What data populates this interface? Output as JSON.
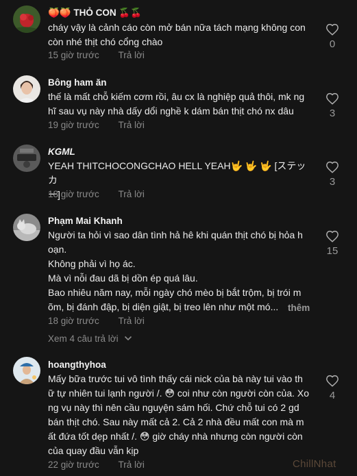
{
  "comments": [
    {
      "username": "🍑🍑 THỎ CON 🍒🍒",
      "lines": [
        "cháy vậy là cảnh cáo còn mở bán nữa tách mạng không con",
        "còn nhé thịt chó cổng chào"
      ],
      "time": "15 giờ trước",
      "reply": "Trả lời",
      "likes": "0",
      "avatar_icon": "avatar-red-flower-icon"
    },
    {
      "username": "Bông ham ăn",
      "lines": [
        "thế là mất chỗ kiếm cơm rồi, âu cx là nghiệp quả thôi, mk ng",
        "hĩ sau vụ này nhà dấy dổi nghề k dám bán thịt chó nx dâu"
      ],
      "time": "19 giờ trước",
      "reply": "Trả lời",
      "likes": "3",
      "avatar_icon": "avatar-woman-portrait-icon"
    },
    {
      "username": "KGML",
      "lines": [
        "YEAH THITCHOCONGCHAO HELL YEAH🤟 🤟 🤟 [ステッカ",
        "ー]"
      ],
      "time": "18 giờ trước",
      "reply": "Trả lời",
      "likes": "3",
      "avatar_icon": "avatar-gray-logo-icon"
    },
    {
      "username": "Phạm Mai Khanh",
      "lines": [
        "Người ta hỏi vì sao dân tình hả hê khi quán thịt chó bị hỏa h",
        "oạn.",
        "Không phải vì họ ác.",
        "Mà vì nỗi đau dã bị dồn ép quá lâu.",
        "Bao nhiêu năm nay, mỗi ngày chó mèo bị bắt trộm, bị trói m",
        "õm, bị đánh đập, bị diện giật, bị treo lên như một mó..."
      ],
      "more": "thêm",
      "time": "18 giờ trước",
      "reply": "Trả lời",
      "likes": "15",
      "view_replies": "Xem 4 câu trả lời",
      "avatar_icon": "avatar-cat-photo-icon"
    },
    {
      "username": "hoangthyhoa",
      "lines": [
        "Mấy bữa trước tui vô tình thấy cái nick của bà này tui vào th",
        "ữ tự nhiên tui lạnh người /. 😳 coi như còn người còn của. Xo",
        "ng vụ này thì nên cầu nguyện sám hối. Chứ chỗ tui có 2 gd",
        "bán thịt chó. Sau này mất cả 2. Cả 2 nhà đều mất con mà m",
        "ất đứa tốt dẹp nhất /. 😳 giờ cháy nhà nhưng còn người còn",
        "của quay đầu vẫn kịp"
      ],
      "time": "22 giờ trước",
      "reply": "Trả lời",
      "likes": "4",
      "avatar_icon": "avatar-person-hat-icon"
    }
  ],
  "watermark": "ChillNhat"
}
